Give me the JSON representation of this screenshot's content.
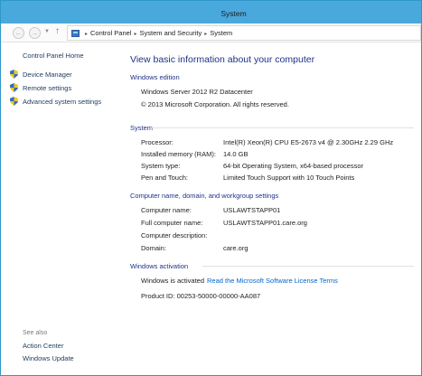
{
  "window": {
    "title": "System"
  },
  "address": {
    "breadcrumbs": [
      "Control Panel",
      "System and Security",
      "System"
    ]
  },
  "sidebar": {
    "home": "Control Panel Home",
    "items": [
      {
        "label": "Device Manager"
      },
      {
        "label": "Remote settings"
      },
      {
        "label": "Advanced system settings"
      }
    ],
    "see_also_label": "See also",
    "see_also": [
      {
        "label": "Action Center"
      },
      {
        "label": "Windows Update"
      }
    ]
  },
  "main": {
    "title": "View basic information about your computer",
    "edition": {
      "heading": "Windows edition",
      "name": "Windows Server 2012 R2 Datacenter",
      "copyright": "© 2013 Microsoft Corporation. All rights reserved."
    },
    "system": {
      "heading": "System",
      "rows": [
        {
          "label": "Processor:",
          "value": "Intel(R) Xeon(R) CPU E5-2673 v4 @ 2.30GHz   2.29 GHz"
        },
        {
          "label": "Installed memory (RAM):",
          "value": "14.0 GB"
        },
        {
          "label": "System type:",
          "value": "64-bit Operating System, x64-based processor"
        },
        {
          "label": "Pen and Touch:",
          "value": "Limited Touch Support with 10 Touch Points"
        }
      ]
    },
    "computer": {
      "heading": "Computer name, domain, and workgroup settings",
      "rows": [
        {
          "label": "Computer name:",
          "value": "USLAWTSTAPP01"
        },
        {
          "label": "Full computer name:",
          "value": "USLAWTSTAPP01.care.org"
        },
        {
          "label": "Computer description:",
          "value": ""
        },
        {
          "label": "Domain:",
          "value": "care.org"
        }
      ]
    },
    "activation": {
      "heading": "Windows activation",
      "status": "Windows is activated",
      "license_link": "Read the Microsoft Software License Terms",
      "product_id": "Product ID: 00253-50000-00000-AA087"
    }
  }
}
